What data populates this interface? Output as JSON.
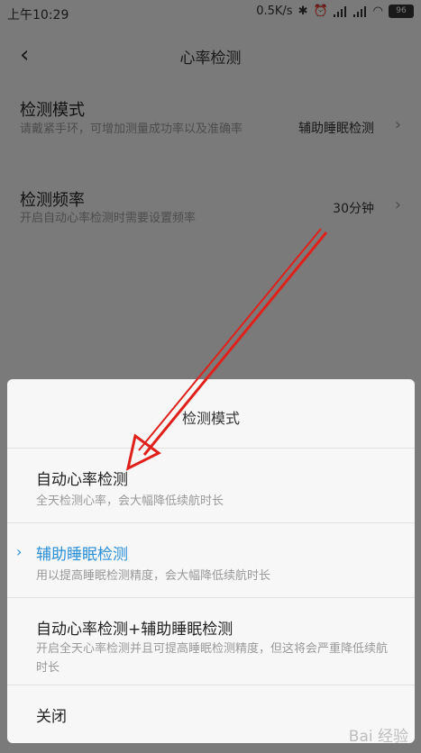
{
  "status": {
    "time": "上午10:29",
    "speed": "0.5K/s",
    "battery": "96"
  },
  "nav": {
    "back": "‹",
    "title": "心率检测"
  },
  "settings": [
    {
      "title": "检测模式",
      "desc": "请戴紧手环，可增加测量成功率以及准确率",
      "value": "辅助睡眠检测"
    },
    {
      "title": "检测频率",
      "desc": "开启自动心率检测时需要设置频率",
      "value": "30分钟"
    }
  ],
  "sheet": {
    "header": "检测模式",
    "options": [
      {
        "title": "自动心率检测",
        "desc": "全天检测心率，会大幅降低续航时长",
        "selected": false
      },
      {
        "title": "辅助睡眠检测",
        "desc": "用以提高睡眠检测精度，会大幅降低续航时长",
        "selected": true
      },
      {
        "title": "自动心率检测+辅助睡眠检测",
        "desc": "开启全天心率检测并且可提高睡眠检测精度，但这将会严重降低续航时长",
        "selected": false
      }
    ],
    "close": "关闭"
  },
  "watermark": "Bai 经验",
  "colors": {
    "accent": "#2a8fd8",
    "arrow": "#e0201a"
  }
}
